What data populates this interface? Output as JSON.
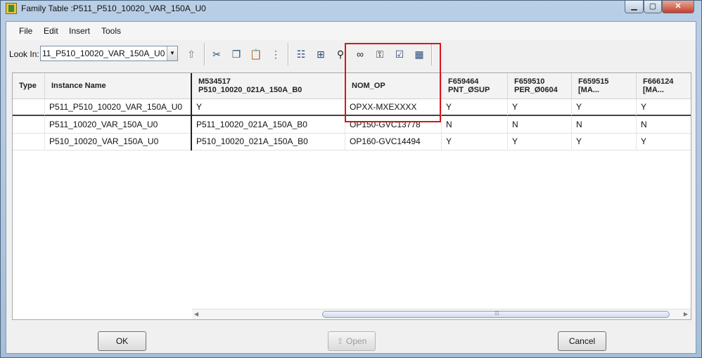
{
  "window": {
    "title": "Family Table :P511_P510_10020_VAR_150A_U0",
    "controls": {
      "minimize": "▁",
      "maximize": "▢",
      "close": "✕"
    }
  },
  "menu": [
    "File",
    "Edit",
    "Insert",
    "Tools"
  ],
  "toolbar": {
    "look_in_label": "Look In:",
    "look_in_value": "11_P510_10020_VAR_150A_U0",
    "icons": [
      "folder-up-icon",
      "cut-icon",
      "copy-icon",
      "paste-icon",
      "paste-special-icon",
      "add-columns-icon",
      "add-instance-icon",
      "find-icon",
      "preview-icon",
      "lock-icon",
      "verify-icon",
      "table-icon"
    ]
  },
  "table": {
    "columns": [
      {
        "line1": "Type",
        "line2": ""
      },
      {
        "line1": "Instance Name",
        "line2": ""
      },
      {
        "line1": "M534517",
        "line2": "P510_10020_021A_150A_B0"
      },
      {
        "line1": "NOM_OP",
        "line2": ""
      },
      {
        "line1": "F659464",
        "line2": "PNT_ØSUP"
      },
      {
        "line1": "F659510",
        "line2": "PER_Ø0604"
      },
      {
        "line1": "F659515",
        "line2": "[MA..."
      },
      {
        "line1": "F666124",
        "line2": "[MA..."
      }
    ],
    "rows": [
      [
        "",
        "P511_P510_10020_VAR_150A_U0",
        "Y",
        "OPXX-MXEXXXX",
        "Y",
        "Y",
        "Y",
        "Y"
      ],
      [
        "",
        "P511_10020_VAR_150A_U0",
        "P511_10020_021A_150A_B0",
        "OP150-GVC13778",
        "N",
        "N",
        "N",
        "N"
      ],
      [
        "",
        "P510_10020_VAR_150A_U0",
        "P510_10020_021A_150A_B0",
        "OP160-GVC14494",
        "Y",
        "Y",
        "Y",
        "Y"
      ]
    ],
    "highlight_color": "#d9141e"
  },
  "buttons": {
    "ok": "OK",
    "open": "Open",
    "cancel": "Cancel"
  }
}
